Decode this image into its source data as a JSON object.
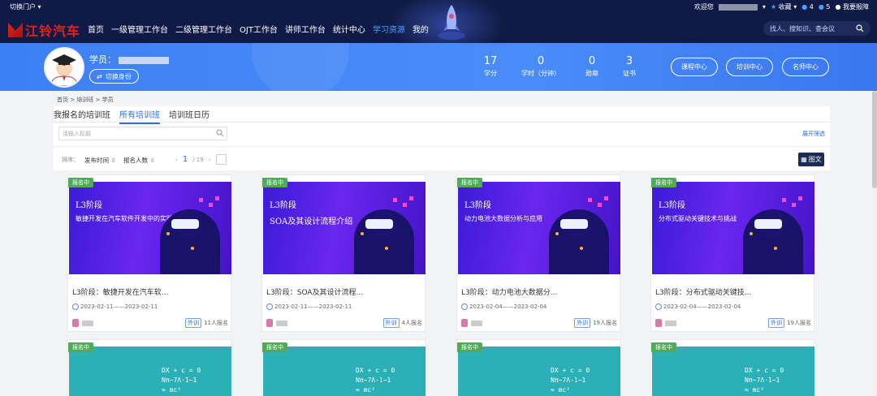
{
  "header": {
    "portal_switch": "切换门户",
    "brand": "江铃汽车",
    "nav": [
      "首页",
      "一级管理工作台",
      "二级管理工作台",
      "OJT工作台",
      "讲师工作台",
      "统计中心",
      "学习资源",
      "我的"
    ],
    "welcome": "欢迎您",
    "favorites": "收藏",
    "msg1": "4",
    "msg2": "5",
    "report": "我要报障",
    "search_placeholder": "找人、搜知识、查会议"
  },
  "profile": {
    "label": "学员：",
    "switch": "切换身份",
    "stats": [
      {
        "num": "17",
        "label": "学分"
      },
      {
        "num": "0",
        "label": "学时（分钟）"
      },
      {
        "num": "0",
        "label": "勋章"
      },
      {
        "num": "3",
        "label": "证书"
      }
    ],
    "buttons": [
      "课程中心",
      "培训中心",
      "名师中心"
    ]
  },
  "breadcrumb": [
    "首页",
    "培训班",
    "学员"
  ],
  "tabs": [
    "我报名的培训班",
    "所有培训班",
    "培训班日历"
  ],
  "filter": {
    "placeholder": "请输入标题",
    "expand": "展开筛选"
  },
  "sort": {
    "label": "排序：",
    "options": [
      "发布时间",
      "报名人数"
    ],
    "page_current": "1",
    "page_total": "/ 19",
    "view": "图文"
  },
  "cards": [
    {
      "badge": "报名中",
      "img_stage": "L3阶段",
      "img_sub": "敏捷开发在汽车软件开发中的实践",
      "title": "L3阶段：敏捷开发在汽车软...",
      "date": "2023-02-11——2023-02-11",
      "type": "外训",
      "enrolled": "11人报名"
    },
    {
      "badge": "报名中",
      "img_stage": "L3阶段",
      "img_sub": "SOA及其设计流程介绍",
      "title": "L3阶段：SOA及其设计流程...",
      "date": "2023-02-11——2023-02-11",
      "type": "外训",
      "enrolled": "4人报名"
    },
    {
      "badge": "报名中",
      "img_stage": "L3阶段",
      "img_sub": "动力电池大数据分析与应用",
      "title": "L3阶段：动力电池大数据分...",
      "date": "2023-02-04——2023-02-04",
      "type": "外训",
      "enrolled": "19人报名"
    },
    {
      "badge": "报名中",
      "img_stage": "L3阶段",
      "img_sub": "分布式驱动关键技术与挑战",
      "title": "L3阶段：分布式驱动关键技...",
      "date": "2023-02-04——2023-02-04",
      "type": "外训",
      "enrolled": "19人报名"
    }
  ],
  "cards_row2": [
    {
      "badge": "报名中",
      "eq": [
        "DX + c = 0",
        "Nπ−7Λ·1−1",
        "≈ mc²"
      ]
    },
    {
      "badge": "报名中",
      "eq": [
        "DX + c = 0",
        "Nπ−7Λ·1−1",
        "≈ mc²"
      ]
    },
    {
      "badge": "报名中",
      "eq": [
        "DX + c = 0",
        "Nπ−7Λ·1−1",
        "≈ mc²"
      ]
    },
    {
      "badge": "报名中",
      "eq": [
        "DX + c = 0",
        "Nπ−7Λ·1−1",
        "≈ mc²"
      ]
    }
  ]
}
